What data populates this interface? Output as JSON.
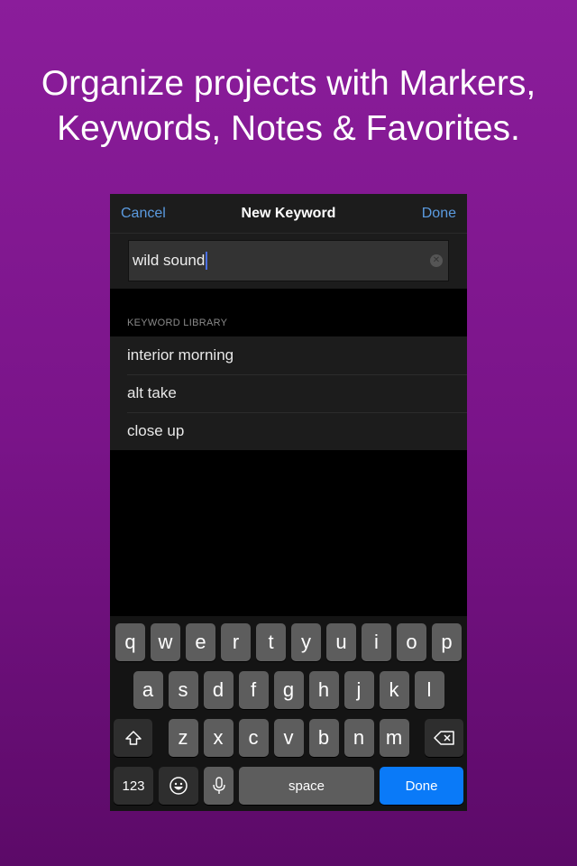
{
  "headline": {
    "line1": "Organize projects with Markers,",
    "line2": "Keywords, Notes & Favorites."
  },
  "nav": {
    "cancel": "Cancel",
    "title": "New Keyword",
    "done": "Done"
  },
  "input": {
    "value": "wild sound"
  },
  "library": {
    "header": "KEYWORD LIBRARY",
    "items": [
      "interior morning",
      "alt take",
      "close up"
    ]
  },
  "keyboard": {
    "row1": [
      "q",
      "w",
      "e",
      "r",
      "t",
      "y",
      "u",
      "i",
      "o",
      "p"
    ],
    "row2": [
      "a",
      "s",
      "d",
      "f",
      "g",
      "h",
      "j",
      "k",
      "l"
    ],
    "row3": [
      "z",
      "x",
      "c",
      "v",
      "b",
      "n",
      "m"
    ],
    "numbers": "123",
    "space": "space",
    "done": "Done"
  },
  "colors": {
    "accent": "#5b9be0",
    "done_key": "#0a7af8",
    "bg_top": "#8b1d9b",
    "bg_bottom": "#5c0a68"
  }
}
